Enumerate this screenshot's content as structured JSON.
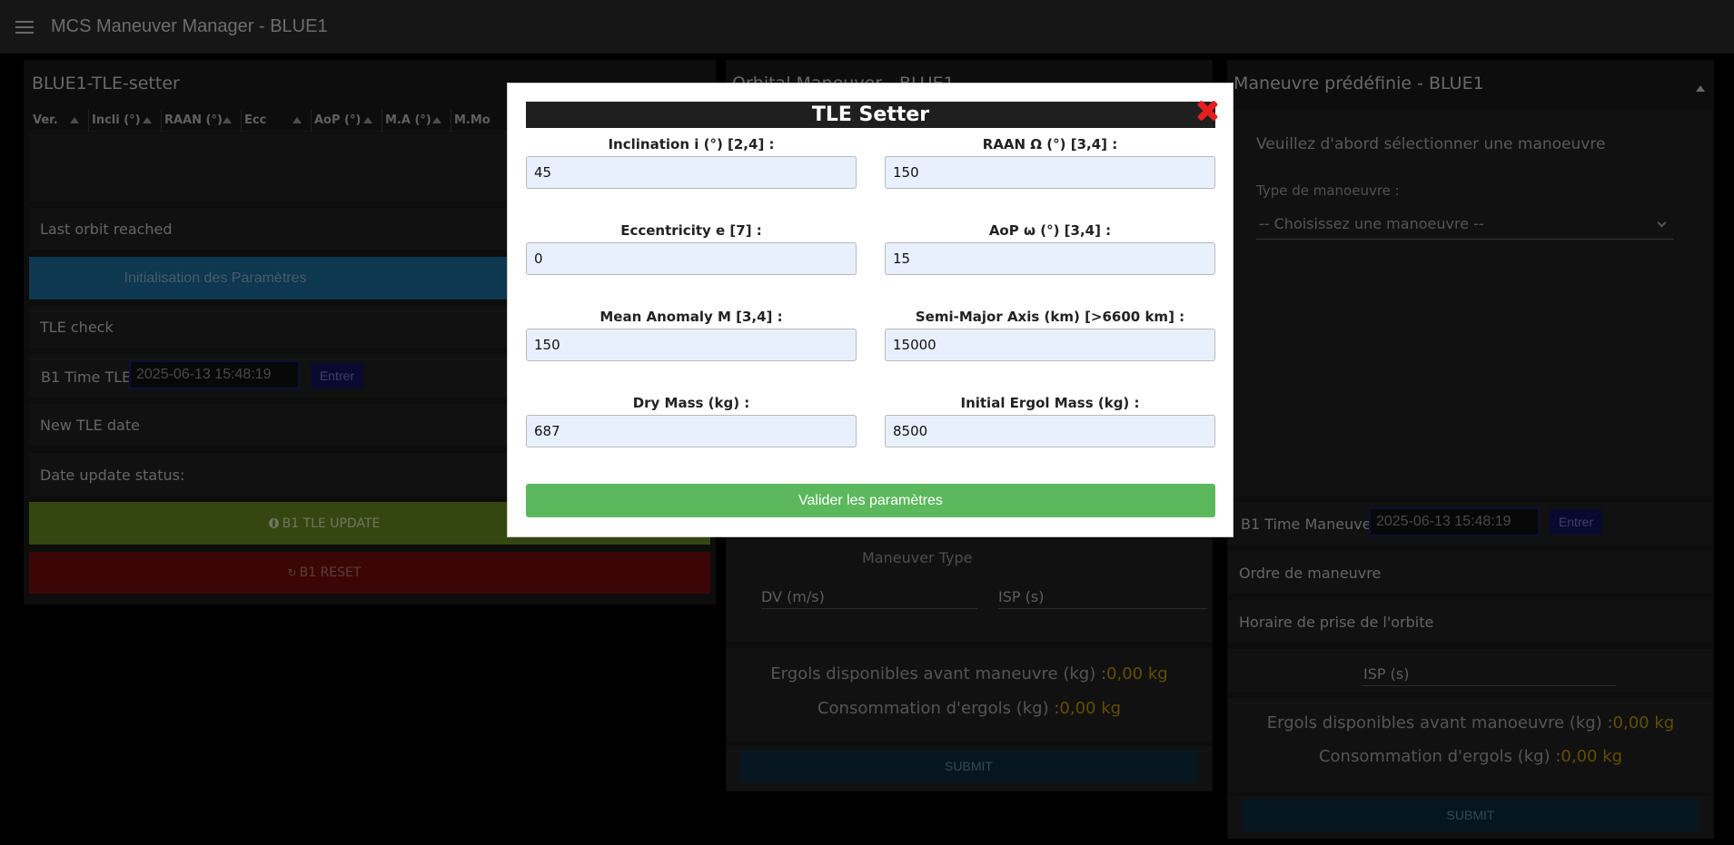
{
  "app": {
    "title": "MCS Maneuver Manager - BLUE1"
  },
  "left_panel": {
    "title": "BLUE1-TLE-setter",
    "columns": [
      "Ver.",
      "Incli (°)",
      "RAAN (°)",
      "Ecc",
      "AoP (°)",
      "M.A (°)",
      "M.Mo"
    ],
    "last_orbit_label": "Last orbit reached",
    "init_button": "Initialisation des Paramètres",
    "tle_check_label": "TLE check",
    "time_label": "B1 Time TLE",
    "time_value": "2025-06-13 15:48:19",
    "enter_button": "Entrer",
    "new_tle_label": "New TLE date",
    "date_update_label": "Date update status:",
    "update_button": "B1 TLE UPDATE",
    "reset_button": "B1 RESET"
  },
  "middle_panel": {
    "title": "Orbital Maneuver - BLUE1",
    "maneuver_type_label": "Maneuver Type",
    "dv_label": "DV (m/s)",
    "isp_label": "ISP (s)",
    "ergols_avail_label": "Ergols disponibles avant maneuvre (kg) :",
    "ergols_avail_value": "0,00 kg",
    "consumption_label": "Consommation d'ergols (kg) :",
    "consumption_value": "0,00 kg",
    "submit": "SUBMIT"
  },
  "right_panel": {
    "title": "Maneuvre prédéfinie - BLUE1",
    "instruction": "Veuillez d'abord sélectionner une manoeuvre",
    "type_label": "Type de manoeuvre :",
    "select_value": "-- Choisissez une manoeuvre --",
    "time_label": "B1 Time Maneuver",
    "time_value": "2025-06-13 15:48:19",
    "enter_button": "Entrer",
    "order_label": "Ordre de maneuvre",
    "orbit_time_label": "Horaire de prise de l'orbite",
    "isp_label": "ISP (s)",
    "ergols_avail_label": "Ergols disponibles avant manoeuvre (kg) :",
    "ergols_avail_value": "0,00 kg",
    "consumption_label": "Consommation d'ergols (kg) :",
    "consumption_value": "0,00 kg",
    "submit": "SUBMIT"
  },
  "modal": {
    "title": "TLE Setter",
    "fields": {
      "inclination": {
        "label": "Inclination i (°) [2,4] :",
        "value": "45"
      },
      "raan": {
        "label": "RAAN Ω (°) [3,4] :",
        "value": "150"
      },
      "eccentricity": {
        "label": "Eccentricity e [7] :",
        "value": "0"
      },
      "aop": {
        "label": "AoP ω (°) [3,4] :",
        "value": "15"
      },
      "mean_anomaly": {
        "label": "Mean Anomaly M [3,4] :",
        "value": "150"
      },
      "semi_major_axis": {
        "label": "Semi-Major Axis (km) [>6600 km] :",
        "value": "15000"
      },
      "dry_mass": {
        "label": "Dry Mass (kg) :",
        "value": "687"
      },
      "ergol_mass": {
        "label": "Initial Ergol Mass (kg) :",
        "value": "8500"
      }
    },
    "validate_button": "Valider les paramètres"
  }
}
